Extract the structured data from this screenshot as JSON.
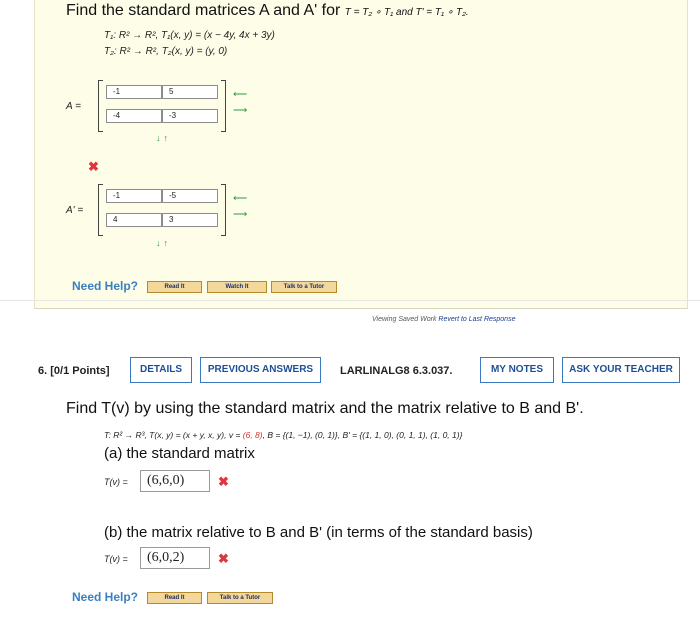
{
  "q5": {
    "title_main": "Find the standard matrices A and A' for ",
    "title_formula": "T = T₂ ∘ T₁ and T' = T₁ ∘ T₂.",
    "t1": "T₁: R² → R², T₁(x, y) = (x − 4y, 4x + 3y)",
    "t2": "T₂: R² → R², T₂(x, y) = (y, 0)",
    "matrix_a": {
      "label": "A =",
      "cells": [
        "-1",
        "5",
        "-4",
        "-3"
      ]
    },
    "matrix_a_prime": {
      "label": "A' =",
      "cells": [
        "-1",
        "-5",
        "4",
        "3"
      ]
    },
    "row_arrows": [
      "⟵",
      "⟶"
    ],
    "col_arrows": "↓↑",
    "wrong_mark": "✖",
    "need_help": "Need Help?",
    "buttons": [
      "Read It",
      "Watch It",
      "Talk to a Tutor"
    ],
    "viewing_text": "Viewing Saved Work",
    "revert_link": "Revert to Last Response"
  },
  "q6": {
    "number": "6.",
    "points": "[0/1 Points]",
    "details_btn": "DETAILS",
    "prev_btn": "PREVIOUS ANSWERS",
    "code": "LARLINALG8 6.3.037.",
    "notes_btn": "MY NOTES",
    "ask_btn": "ASK YOUR TEACHER",
    "prompt": "Find T(v) by using the standard matrix and the matrix relative to B and B'.",
    "given_pre": "T: R² → R³,  T(x, y) = (x + y, x, y),  v = ",
    "given_v": "(6, 8)",
    "given_post": ",  B = {(1, −1), (0, 1)},  B' = {(1, 1, 0), (0, 1, 1), (1, 0, 1)}",
    "part_a": "(a) the standard matrix",
    "tv_label": "T(v) =",
    "answer_a": "(6,6,0)",
    "part_b": "(b) the matrix relative to B and B' (in terms of the standard basis)",
    "answer_b": "(6,0,2)",
    "wrong_mark": "✖",
    "need_help": "Need Help?",
    "buttons": [
      "Read It",
      "Talk to a Tutor"
    ]
  },
  "colors": {
    "panel": "#fdfde8",
    "accent_blue": "#3a78c0",
    "wrong_red": "#e0353b",
    "arrow_green": "#2a9d3e",
    "help_button": "#f4d79a"
  }
}
